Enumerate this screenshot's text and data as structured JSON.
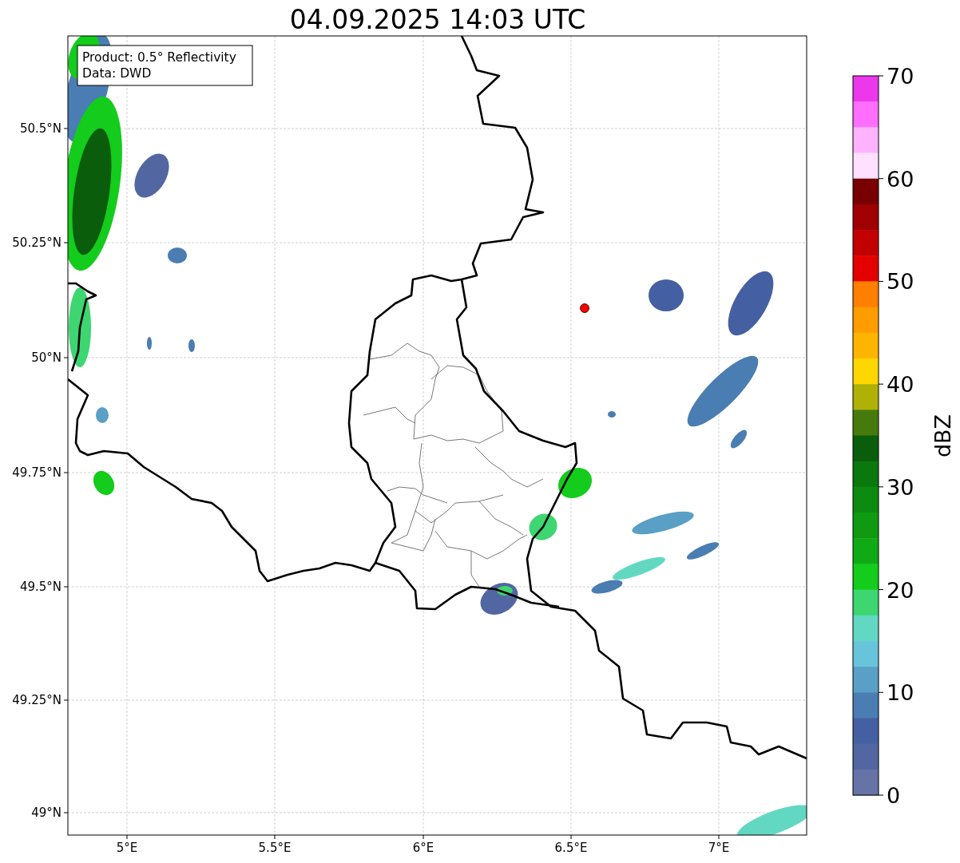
{
  "title": "04.09.2025 14:03 UTC",
  "legend": [
    "Product: 0.5° Reflectivity",
    "Data: DWD"
  ],
  "map": {
    "marker": {
      "color": "#ff0000"
    }
  },
  "x_ticks": [
    "5°E",
    "5.5°E",
    "6°E",
    "6.5°E",
    "7°E"
  ],
  "y_ticks": [
    "50.5°N",
    "50.25°N",
    "50°N",
    "49.75°N",
    "49.5°N",
    "49.25°N",
    "49°N"
  ],
  "colorbar": {
    "label": "dBZ",
    "ticks": [
      "70",
      "60",
      "50",
      "40",
      "30",
      "20",
      "10",
      "0"
    ],
    "segments": [
      {
        "color": "#ec38ec"
      },
      {
        "color": "#ff6eff"
      },
      {
        "color": "#ffb3ff"
      },
      {
        "color": "#ffe0ff"
      },
      {
        "color": "#780000"
      },
      {
        "color": "#a00000"
      },
      {
        "color": "#c20000"
      },
      {
        "color": "#e50000"
      },
      {
        "color": "#ff7f00"
      },
      {
        "color": "#ff9c00"
      },
      {
        "color": "#ffb500"
      },
      {
        "color": "#ffd700"
      },
      {
        "color": "#b0b106"
      },
      {
        "color": "#477a0d"
      },
      {
        "color": "#0a5e0b"
      },
      {
        "color": "#0b780e"
      },
      {
        "color": "#0d8a10"
      },
      {
        "color": "#0f9a12"
      },
      {
        "color": "#10ab14"
      },
      {
        "color": "#13cc1b"
      },
      {
        "color": "#3dd670"
      },
      {
        "color": "#62d8c3"
      },
      {
        "color": "#68c4db"
      },
      {
        "color": "#5a9fc6"
      },
      {
        "color": "#4a7db2"
      },
      {
        "color": "#4460a2"
      },
      {
        "color": "#5267a1"
      },
      {
        "color": "#6573a6"
      }
    ]
  }
}
